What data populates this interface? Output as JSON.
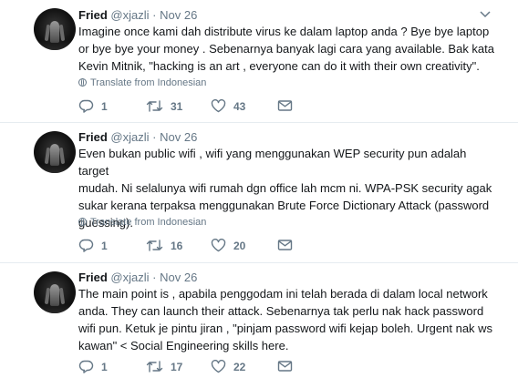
{
  "colors": {
    "text": "#14171a",
    "muted": "#657786",
    "divider": "#e6ecf0"
  },
  "tweets": [
    {
      "name": "Fried",
      "handle": "@xjazli",
      "sep": "·",
      "time": "Nov 26",
      "lines": [
        "Imagine once kami dah distribute virus ke dalam laptop anda ? Bye  bye laptop",
        "or bye bye your money . Sebenarnya banyak lagi cara yang available. Bak kata",
        "Kevin Mitnik, \"hacking is an art , everyone can do it with their own creativity\"."
      ],
      "translate": "Translate from Indonesian",
      "replies": "1",
      "retweets": "31",
      "likes": "43"
    },
    {
      "name": "Fried",
      "handle": "@xjazli",
      "sep": "·",
      "time": "Nov 26",
      "lines": [
        "Even bukan public wifi , wifi yang menggunakan WEP security pun adalah target",
        "mudah. Ni selalunya wifi rumah dgn office lah mcm ni. WPA-PSK security agak",
        "sukar kerana terpaksa menggunakan Brute Force Dictionary Attack (password",
        "guessing)."
      ],
      "translate": "Translate from Indonesian",
      "replies": "1",
      "retweets": "16",
      "likes": "20"
    },
    {
      "name": "Fried",
      "handle": "@xjazli",
      "sep": "·",
      "time": "Nov 26",
      "lines": [
        "The main point is , apabila penggodam ini telah berada di dalam local network",
        "anda. They can launch their attack. Sebenarnya tak perlu nak hack password",
        "wifi pun. Ketuk je pintu jiran , \"pinjam password wifi kejap boleh. Urgent nak ws",
        "kawan\" < Social Engineering skills here."
      ],
      "replies": "1",
      "retweets": "17",
      "likes": "22"
    }
  ]
}
